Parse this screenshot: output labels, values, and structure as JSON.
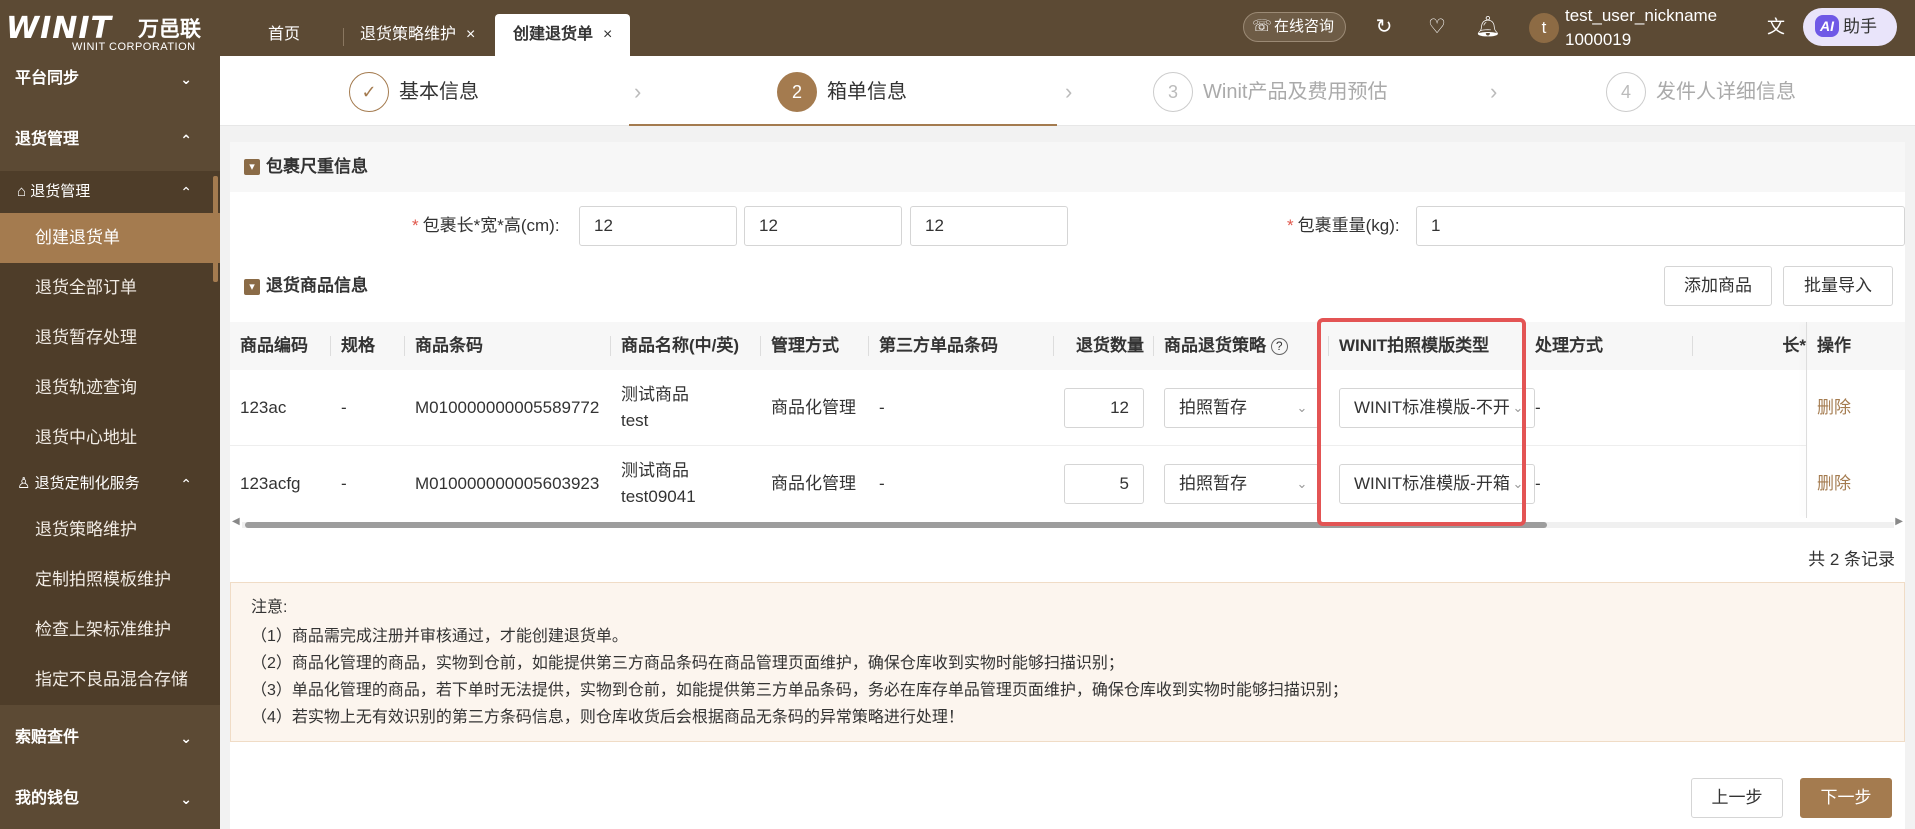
{
  "topbar": {
    "logo_mark": "WINIT",
    "logo_cn": "万邑联",
    "logo_en": "WINIT CORPORATION",
    "tabs": [
      {
        "label": "首页"
      },
      {
        "label": "退货策略维护",
        "close": "×"
      },
      {
        "label": "创建退货单",
        "close": "×"
      }
    ],
    "consult_label": "在线咨询",
    "avatar_letter": "t",
    "username": "test_user_nickname",
    "user_id": "1000019",
    "ai_badge": "AI",
    "ai_label": "助手",
    "icons": [
      "headset-icon",
      "refresh-icon",
      "heart-icon",
      "bell-icon",
      "translate-icon"
    ]
  },
  "sidebar": {
    "groups": [
      {
        "label": "平台同步",
        "chev": "⌄"
      },
      {
        "label": "退货管理",
        "chev": "⌃"
      },
      {
        "label": "索赔查件",
        "chev": "⌄"
      },
      {
        "label": "我的钱包",
        "chev": "⌄"
      }
    ],
    "sub1": {
      "label": "退货管理",
      "chev": "⌃"
    },
    "sub1_items": [
      "创建退货单",
      "退货全部订单",
      "退货暂存处理",
      "退货轨迹查询",
      "退货中心地址"
    ],
    "sub2": {
      "label": "退货定制化服务",
      "chev": "⌃"
    },
    "sub2_items": [
      "退货策略维护",
      "定制拍照模板维护",
      "检查上架标准维护",
      "指定不良品混合存储"
    ]
  },
  "steps": [
    {
      "num": "✓",
      "label": "基本信息",
      "state": "done"
    },
    {
      "num": "2",
      "label": "箱单信息",
      "state": "active"
    },
    {
      "num": "3",
      "label": "Winit产品及费用预估",
      "state": "disabled"
    },
    {
      "num": "4",
      "label": "发件人详细信息",
      "state": "disabled"
    }
  ],
  "package": {
    "section_title": "包裹尺重信息",
    "dims_label": "包裹长*宽*高(cm):",
    "length": "12",
    "width": "12",
    "height": "12",
    "weight_label": "包裹重量(kg):",
    "weight": "1"
  },
  "goods": {
    "section_title": "退货商品信息",
    "add_button": "添加商品",
    "import_button": "批量导入",
    "columns": [
      "商品编码",
      "规格",
      "商品条码",
      "商品名称(中/英)",
      "管理方式",
      "第三方单品条码",
      "退货数量",
      "商品退货策略",
      "WINIT拍照模版类型",
      "处理方式",
      "长*",
      "操作"
    ],
    "help_icon": "?",
    "rows": [
      {
        "code": "123ac",
        "spec": "-",
        "barcode": "M010000000005589772",
        "name_cn": "测试商品",
        "name_en": "test",
        "manage": "商品化管理",
        "third_code": "-",
        "qty": "12",
        "strategy": "拍照暂存",
        "template": "WINIT标准模版-不开箱",
        "process": "-",
        "action": "删除"
      },
      {
        "code": "123acfg",
        "spec": "-",
        "barcode": "M010000000005603923",
        "name_cn": "测试商品",
        "name_en": "test09041",
        "manage": "商品化管理",
        "third_code": "-",
        "qty": "5",
        "strategy": "拍照暂存",
        "template": "WINIT标准模版-开箱",
        "process": "-",
        "action": "删除"
      }
    ],
    "total": "共 2 条记录"
  },
  "notice": {
    "head": "注意:",
    "lines": [
      "（1）商品需完成注册并审核通过，才能创建退货单。",
      "（2）商品化管理的商品，实物到仓前，如能提供第三方商品条码在商品管理页面维护，确保仓库收到实物时能够扫描识别；",
      "（3）单品化管理的商品，若下单时无法提供，实物到仓前，如能提供第三方单品条码，务必在库存单品管理页面维护，确保仓库收到实物时能够扫描识别；",
      "（4）若实物上无有效识别的第三方条码信息，则仓库收货后会根据商品无条码的异常策略进行处理！"
    ]
  },
  "footer": {
    "prev": "上一步",
    "next": "下一步"
  },
  "colors": {
    "brand": "#5c4a34",
    "accent": "#a47b4f",
    "highlight": "#e35454"
  }
}
